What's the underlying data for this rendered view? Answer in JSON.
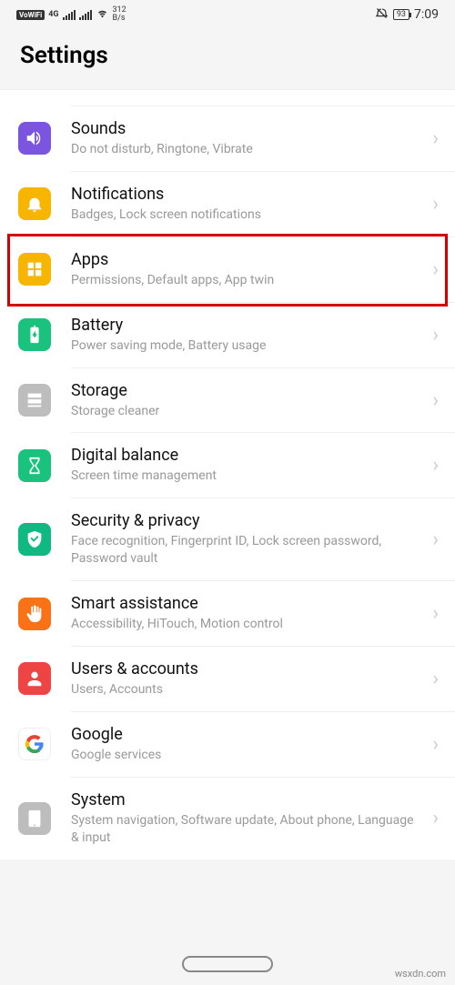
{
  "statusbar": {
    "vowifi": "VoWiFi",
    "net": "4G",
    "speed_top": "312",
    "speed_bot": "B/s",
    "battery": "93",
    "time": "7:09"
  },
  "header": {
    "title": "Settings"
  },
  "rows": [
    {
      "id": "sounds",
      "title": "Sounds",
      "sub": "Do not disturb, Ringtone, Vibrate"
    },
    {
      "id": "notifications",
      "title": "Notifications",
      "sub": "Badges, Lock screen notifications"
    },
    {
      "id": "apps",
      "title": "Apps",
      "sub": "Permissions, Default apps, App twin"
    },
    {
      "id": "battery",
      "title": "Battery",
      "sub": "Power saving mode, Battery usage"
    },
    {
      "id": "storage",
      "title": "Storage",
      "sub": "Storage cleaner"
    },
    {
      "id": "digital",
      "title": "Digital balance",
      "sub": "Screen time management"
    },
    {
      "id": "security",
      "title": "Security & privacy",
      "sub": "Face recognition, Fingerprint ID, Lock screen password, Password vault"
    },
    {
      "id": "smart",
      "title": "Smart assistance",
      "sub": "Accessibility, HiTouch, Motion control"
    },
    {
      "id": "users",
      "title": "Users & accounts",
      "sub": "Users, Accounts"
    },
    {
      "id": "google",
      "title": "Google",
      "sub": "Google services"
    },
    {
      "id": "system",
      "title": "System",
      "sub": "System navigation, Software update, About phone, Language & input"
    }
  ],
  "watermark": "wsxdn.com"
}
